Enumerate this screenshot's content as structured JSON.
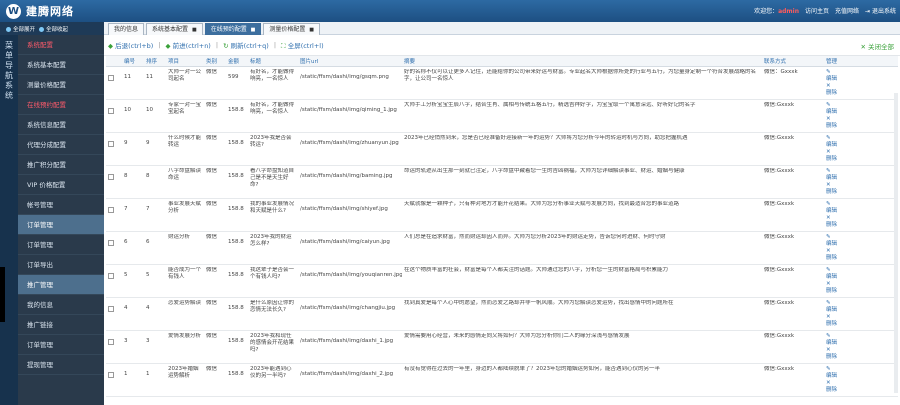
{
  "header": {
    "logo_mark": "W",
    "title": "建腾网络",
    "welcome": "欢迎您：",
    "user": "admin",
    "link_home": "访问主页",
    "link_recharge": "充值网络",
    "logout": "退出系统"
  },
  "toggles": {
    "expand_all": "全部展开",
    "collapse_all": "全部收起"
  },
  "tabs": [
    {
      "label": "我的信息"
    },
    {
      "label": "系统基本配置"
    },
    {
      "label": "在线预约配置"
    },
    {
      "label": "测量价格配置"
    }
  ],
  "rail": {
    "text": "菜单导航系统"
  },
  "sidebar": {
    "items": [
      {
        "label": "系统配置"
      },
      {
        "label": "系统基本配置"
      },
      {
        "label": "测量价格配置"
      },
      {
        "label": "在线预约配置"
      },
      {
        "label": "系统信息配置"
      },
      {
        "label": "代理分成配置"
      },
      {
        "label": "推广积分配置"
      },
      {
        "label": "VIP 价格配置"
      },
      {
        "label": "帐号管理"
      },
      {
        "label": "订单管理"
      },
      {
        "label": "订单管理"
      },
      {
        "label": "订单导出"
      },
      {
        "label": "推广管理"
      },
      {
        "label": "我的信息"
      },
      {
        "label": "推广链接"
      },
      {
        "label": "订单管理"
      },
      {
        "label": "提现管理"
      }
    ]
  },
  "toolbar": {
    "back": "后退(ctrl+b)",
    "forward": "前进(ctrl+n)",
    "refresh": "刷新(ctrl+q)",
    "fullscreen": "全屏(ctrl+l)",
    "close_all": "关闭全部"
  },
  "table": {
    "headers": [
      "编号",
      "排序",
      "项目",
      "类别",
      "金额",
      "标题",
      "图片url",
      "摘要",
      "联系方式",
      "管理"
    ],
    "op_edit": "编辑",
    "op_delete": "删除",
    "rows": [
      {
        "id": "11",
        "sort": "11",
        "project": "大师一对一公司起名",
        "cat": "微信",
        "amount": "599",
        "title": "有好名，才能做得响亮，一名惊人",
        "url": "/static/ffsm/dashi/img/gsqm.png",
        "summary": "好的名称不仅可以让更多人记住，还能给你的公司带来好运与财富。专业起名大师根据你所处的行业与五行，为您量身定制一个符合发展战略的名字，让公司一名惊人",
        "contact": "微信：Gxxxk"
      },
      {
        "id": "10",
        "sort": "10",
        "project": "专家一对一宝宝起名",
        "cat": "微信",
        "amount": "158.8",
        "title": "有好名，才能做得响亮，一名惊人",
        "url": "/static/ffsm/dashi/img/qiming_1.jpg",
        "summary": "大师手工分析宝宝生辰八字，结合生肖、属相与传统五格五行，精选吉祥好字，为宝宝取一个寓意深远、好听好记的名字",
        "contact": "微信:Gxxxk"
      },
      {
        "id": "9",
        "sort": "9",
        "project": "什么时候才能转运",
        "cat": "微信",
        "amount": "158.8",
        "title": "2023年我是否会转运?",
        "url": "/static/ffsm/dashi/img/zhuanyun.jpg",
        "summary": "2023年已经悄然到来，您是否已经准备好迎接新一年的运势？大师将为您分析今年的转运时机与方向，助您把握机遇",
        "contact": "微信:Gxxxk"
      },
      {
        "id": "8",
        "sort": "8",
        "project": "八字命盘解读命运",
        "cat": "微信",
        "amount": "158.8",
        "title": "看八字命盘知道自己是不是天生好命?",
        "url": "/static/ffsm/dashi/img/baming.jpg",
        "summary": "命运的轨迹从出生那一刻就已注定，八字命盘中藏着您一生的吉凶祸福，大师为您详细解读事业、财运、婚姻与健康",
        "contact": "微信:Gxxxk"
      },
      {
        "id": "7",
        "sort": "7",
        "project": "事业发展天赋分析",
        "cat": "微信",
        "amount": "158.8",
        "title": "我的事业发展情况和天赋是什么?",
        "url": "/static/ffsm/dashi/img/shiyef.jpg",
        "summary": "天赋就像是一颗种子，只有种对地方才能开花结果。大师为您分析事业天赋与发展方向，找到最适合您的事业道路",
        "contact": "微信:Gxxxk"
      },
      {
        "id": "6",
        "sort": "6",
        "project": "财运分析",
        "cat": "微信",
        "amount": "158.8",
        "title": "2023年我的财运怎么样?",
        "url": "/static/ffsm/dashi/img/caiyun.jpg",
        "summary": "人们总是在追求财富，然而财运却因人而异。大师为您分析2023年的财运走势，告诉您何时进财、何时守财",
        "contact": "微信:Gxxxk"
      },
      {
        "id": "5",
        "sort": "5",
        "project": "能否成为一个有钱人",
        "cat": "微信",
        "amount": "158.8",
        "title": "我这辈子是否会一个有钱人吗?",
        "url": "/static/ffsm/dashi/img/youqianren.jpg",
        "summary": "在这个物质丰富的社会，财富是每个人都关注的话题。大师通过您的八字，分析您一生的财富格局与积累能力",
        "contact": "微信:Gxxxk"
      },
      {
        "id": "4",
        "sort": "4",
        "project": "恋爱运势解读",
        "cat": "微信",
        "amount": "158.8",
        "title": "是什么原因让你的恋情无法长久?",
        "url": "/static/ffsm/dashi/img/changjiu.jpg",
        "summary": "找到真爱是每个人心中的愿望，然而恋爱之路却并非一帆风顺。大师为您解读恋爱运势，找出感情中的问题所在",
        "contact": "微信:Gxxxk"
      },
      {
        "id": "3",
        "sort": "3",
        "project": "爱情发展分析",
        "cat": "微信",
        "amount": "158.8",
        "title": "2023年我和现任的感情会开花结果吗?",
        "url": "/static/ffsm/dashi/img/daxhi_1.jpg",
        "summary": "爱情需要用心经营，未来的感情走向又将如何？大师为您分析你们二人的缘分深浅与感情发展",
        "contact": "微信:Gxxxk"
      },
      {
        "id": "1",
        "sort": "1",
        "project": "2023年婚姻运势解析",
        "cat": "微信",
        "amount": "158.8",
        "title": "2023年能遇到心仪的另一半吗?",
        "url": "/static/ffsm/dashi/img/daxhi_2.jpg",
        "summary": "有没有觉得在过去的一年里，身边的人都陆续脱单了？2023年您的婚姻运势如何，能否遇到心仪的另一半",
        "contact": "微信:Gxxxk"
      }
    ]
  }
}
